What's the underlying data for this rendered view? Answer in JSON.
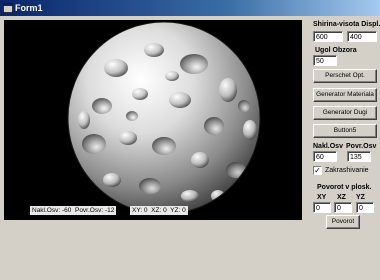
{
  "window": {
    "title": "Form1"
  },
  "viewport": {
    "overlay_left": "Nakl.Osv: -60  Povr.Osv: -12",
    "overlay_right": "XY: 0  XZ: 0  YZ: 0"
  },
  "panel": {
    "display_label": "Shirina-visota Displ.",
    "width_value": "600",
    "height_value": "400",
    "angle_label": "Ugol Obzora",
    "angle_value": "50",
    "btn_perschet": "Perschet Opt.",
    "btn_generator_materiala": "Generator Materiala",
    "btn_generator_dugi": "Generator Dugi",
    "btn_button5": "Button5",
    "nakl_label": "Nakl.Osv",
    "povr_label": "Povr.Osv",
    "nakl_value": "60",
    "povr_value": "135",
    "checkbox_label": "Zakrashivanie",
    "checkbox_checked": true,
    "rotation_label": "Povorot v plosk.",
    "xy_label": "XY",
    "xz_label": "XZ",
    "yz_label": "YZ",
    "xy_value": "0",
    "xz_value": "0",
    "yz_value": "0",
    "btn_povorot": "Povorot"
  }
}
